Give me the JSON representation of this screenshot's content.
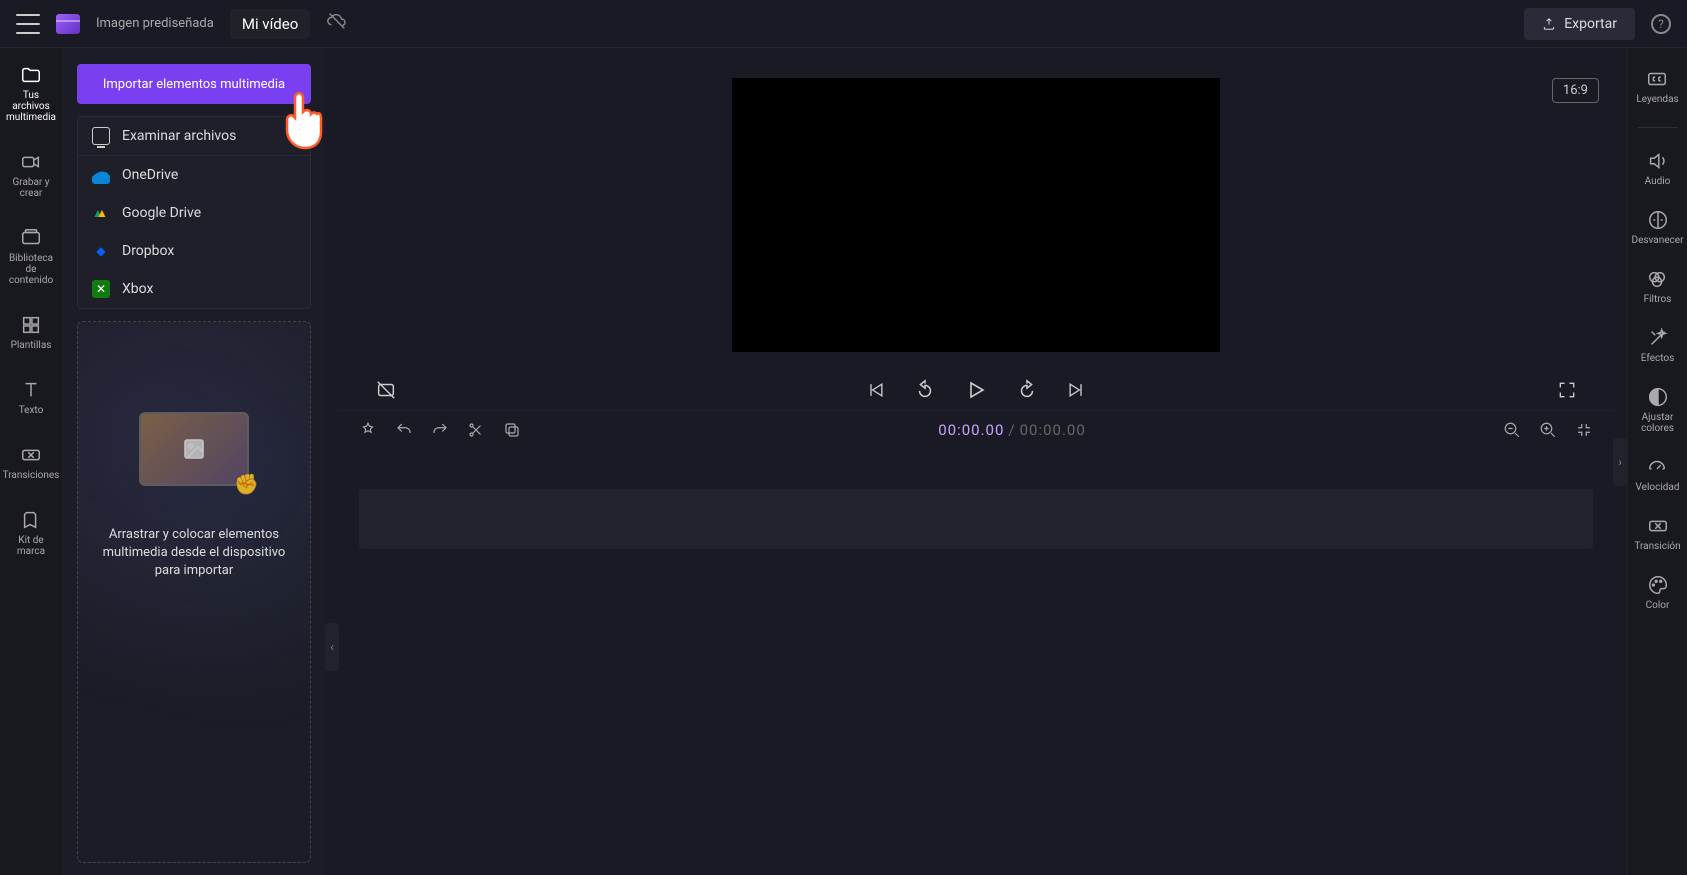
{
  "topbar": {
    "clipart_label": "Imagen prediseñada",
    "video_title": "Mi vídeo",
    "export_label": "Exportar"
  },
  "left_sidebar": {
    "items": [
      {
        "label": "Tus archivos multimedia"
      },
      {
        "label": "Grabar y crear"
      },
      {
        "label": "Biblioteca de contenido"
      },
      {
        "label": "Plantillas"
      },
      {
        "label": "Texto"
      },
      {
        "label": "Transiciones"
      },
      {
        "label": "Kit de marca"
      }
    ]
  },
  "import": {
    "button_label": "Importar elementos multimedia",
    "options": [
      {
        "label": "Examinar archivos"
      },
      {
        "label": "OneDrive"
      },
      {
        "label": "Google Drive"
      },
      {
        "label": "Dropbox"
      },
      {
        "label": "Xbox"
      }
    ]
  },
  "dropzone": {
    "text": "Arrastrar y colocar elementos multimedia desde el dispositivo para importar"
  },
  "preview": {
    "aspect_ratio": "16:9"
  },
  "timeline": {
    "current_time": "00:00.00",
    "total_time": "00:00.00"
  },
  "right_sidebar": {
    "items": [
      {
        "label": "Leyendas"
      },
      {
        "label": "Audio"
      },
      {
        "label": "Desvanecer"
      },
      {
        "label": "Filtros"
      },
      {
        "label": "Efectos"
      },
      {
        "label": "Ajustar colores"
      },
      {
        "label": "Velocidad"
      },
      {
        "label": "Transición"
      },
      {
        "label": "Color"
      }
    ]
  }
}
